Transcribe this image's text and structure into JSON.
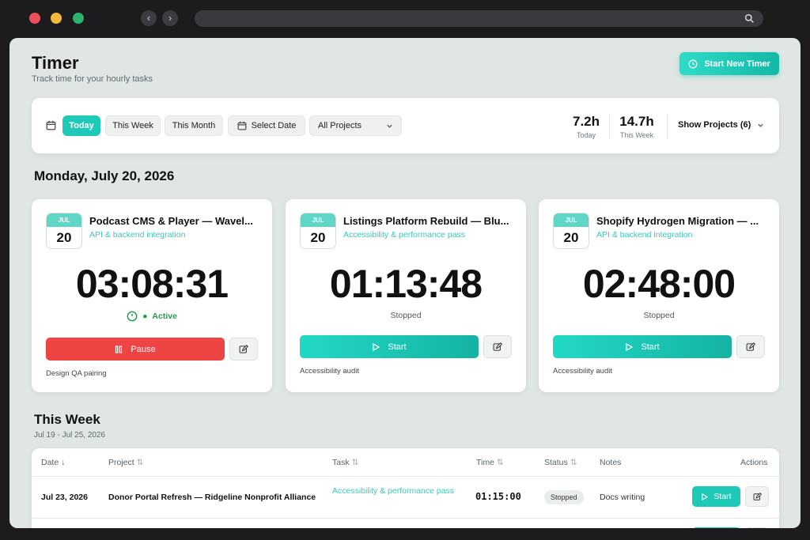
{
  "header": {
    "title": "Timer",
    "subtitle": "Track time for your hourly tasks",
    "start_new_label": "Start New Timer"
  },
  "filters": {
    "today": "Today",
    "this_week": "This Week",
    "this_month": "This Month",
    "select_date": "Select Date",
    "project_select": "All Projects",
    "show_projects": "Show Projects (6)"
  },
  "stats": [
    {
      "value": "7.2h",
      "label": "Today"
    },
    {
      "value": "14.7h",
      "label": "This Week"
    }
  ],
  "day_heading": "Monday, July 20, 2026",
  "timers": [
    {
      "month": "JUL",
      "day": "20",
      "title": "Podcast CMS & Player — Wavel...",
      "subtitle": "API & backend integration",
      "time": "03:08:31",
      "status": "Active",
      "action": "Pause",
      "note": "Design QA pairing"
    },
    {
      "month": "JUL",
      "day": "20",
      "title": "Listings Platform Rebuild — Blu...",
      "subtitle": "Accessibility & performance pass",
      "time": "01:13:48",
      "status": "Stopped",
      "action": "Start",
      "note": "Accessibility audit"
    },
    {
      "month": "JUL",
      "day": "20",
      "title": "Shopify Hydrogen Migration — ...",
      "subtitle": "API & backend integration",
      "time": "02:48:00",
      "status": "Stopped",
      "action": "Start",
      "note": "Accessibility audit"
    }
  ],
  "week": {
    "heading": "This Week",
    "range": "Jul 19 - Jul 25, 2026",
    "columns": [
      "Date",
      "Project",
      "Task",
      "Time",
      "Status",
      "Notes",
      "Actions"
    ],
    "rows": [
      {
        "date": "Jul 23, 2026",
        "project": "Donor Portal Refresh — Ridgeline Nonprofit Alliance",
        "task": "Accessibility & performance pass",
        "time": "01:15:00",
        "status": "Stopped",
        "notes": "Docs writing",
        "action": "Start"
      }
    ]
  },
  "colors": {
    "accent": "#1fc9b8",
    "danger": "#ef4444",
    "active": "#1c9d4a"
  },
  "icons": {
    "calendar": "calendar-icon",
    "clock": "clock-icon",
    "play": "play-icon",
    "pause": "pause-icon",
    "edit": "edit-icon",
    "chevron": "chevron-down-icon",
    "search": "search-icon"
  }
}
